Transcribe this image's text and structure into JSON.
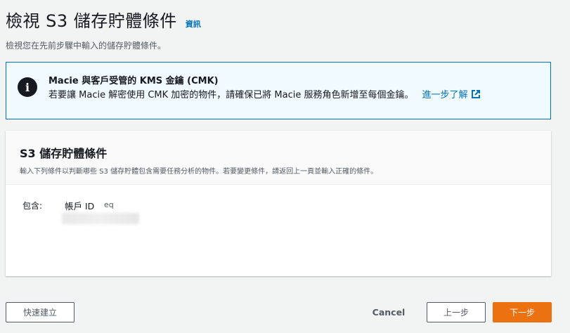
{
  "header": {
    "title": "檢視 S3 儲存貯體條件",
    "info_link": "資訊",
    "subtitle": "檢視您在先前步驟中輸入的儲存貯體條件。"
  },
  "alert": {
    "title": "Macie 與客戶受管的 KMS 金鑰 (CMK)",
    "text": "若要讓 Macie 解密使用 CMK 加密的物件，請確保已將 Macie 服務角色新增至每個金鑰。",
    "link": "進一步了解",
    "icon": "info-icon",
    "accent_color": "#0073bb"
  },
  "card": {
    "title": "S3 儲存貯體條件",
    "description": "輸入下列條件以判斷哪些 S3 儲存貯體包含需要任務分析的物件。若要變更條件，請返回上一頁並輸入正確的條件。",
    "condition": {
      "label": "包含:",
      "key": "帳戶 ID",
      "operator": "eq"
    }
  },
  "footer": {
    "quick_create": "快速建立",
    "cancel": "Cancel",
    "previous": "上一步",
    "next": "下一步",
    "primary_color": "#ec7211"
  }
}
